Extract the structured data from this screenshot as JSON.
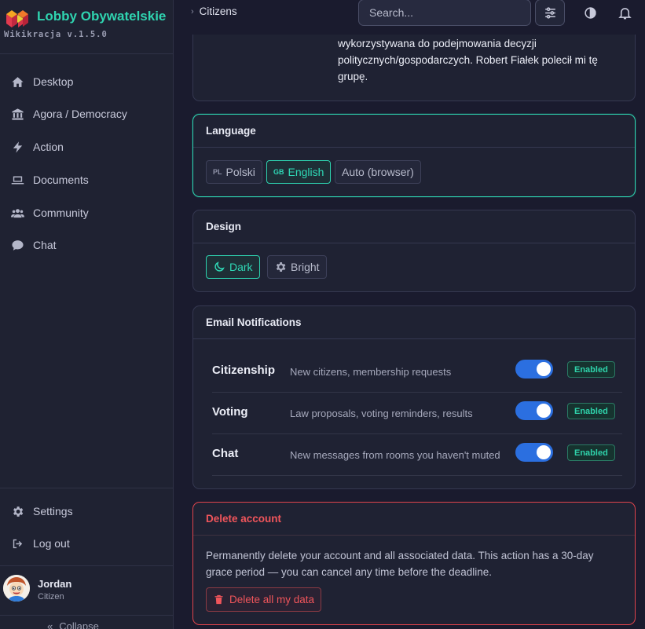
{
  "brand": {
    "name": "Lobby Obywatelskie",
    "version": "Wikikracja v.1.5.0"
  },
  "nav": {
    "items": [
      {
        "label": "Desktop",
        "icon": "home-icon"
      },
      {
        "label": "Agora / Democracy",
        "icon": "building-columns-icon"
      },
      {
        "label": "Action",
        "icon": "lightning-icon"
      },
      {
        "label": "Documents",
        "icon": "laptop-icon"
      },
      {
        "label": "Community",
        "icon": "users-icon"
      },
      {
        "label": "Chat",
        "icon": "chat-bubble-icon"
      }
    ],
    "bottom": [
      {
        "label": "Settings",
        "icon": "gear-icon"
      },
      {
        "label": "Log out",
        "icon": "logout-icon"
      }
    ],
    "collapse_label": "Collapse"
  },
  "user": {
    "name": "Jordan",
    "role": "Citizen"
  },
  "topbar": {
    "breadcrumb": "Citizens",
    "search_placeholder": "Search..."
  },
  "profile_note": {
    "lines": [
      "wykorzystywana do podejmowania decyzji",
      "politycznych/gospodarczych. Robert Fiałek polecił mi tę",
      "grupę."
    ]
  },
  "language": {
    "title": "Language",
    "options": [
      {
        "flag": "PL",
        "label": "Polski",
        "active": false
      },
      {
        "flag": "GB",
        "label": "English",
        "active": true
      },
      {
        "flag": "",
        "label": "Auto (browser)",
        "active": false
      }
    ]
  },
  "design": {
    "title": "Design",
    "options": [
      {
        "label": "Dark",
        "icon": "moon-icon",
        "active": true
      },
      {
        "label": "Bright",
        "icon": "gear-icon",
        "active": false
      }
    ]
  },
  "notifications": {
    "title": "Email Notifications",
    "rows": [
      {
        "title": "Citizenship",
        "desc": "New citizens, membership requests",
        "enabled": true,
        "status": "Enabled"
      },
      {
        "title": "Voting",
        "desc": "Law proposals, voting reminders, results",
        "enabled": true,
        "status": "Enabled"
      },
      {
        "title": "Chat",
        "desc": "New messages from rooms you haven't muted",
        "enabled": true,
        "status": "Enabled"
      }
    ]
  },
  "delete_account": {
    "title": "Delete account",
    "text": "Permanently delete your account and all associated data. This action has a 30-day grace period — you can cancel any time before the deadline.",
    "button": "Delete all my data"
  },
  "colors": {
    "accent": "#2ed3b0",
    "danger": "#f0555b",
    "toggle": "#2b6fe0",
    "background": "#1a1b2e",
    "sidebar": "#1f2232"
  }
}
